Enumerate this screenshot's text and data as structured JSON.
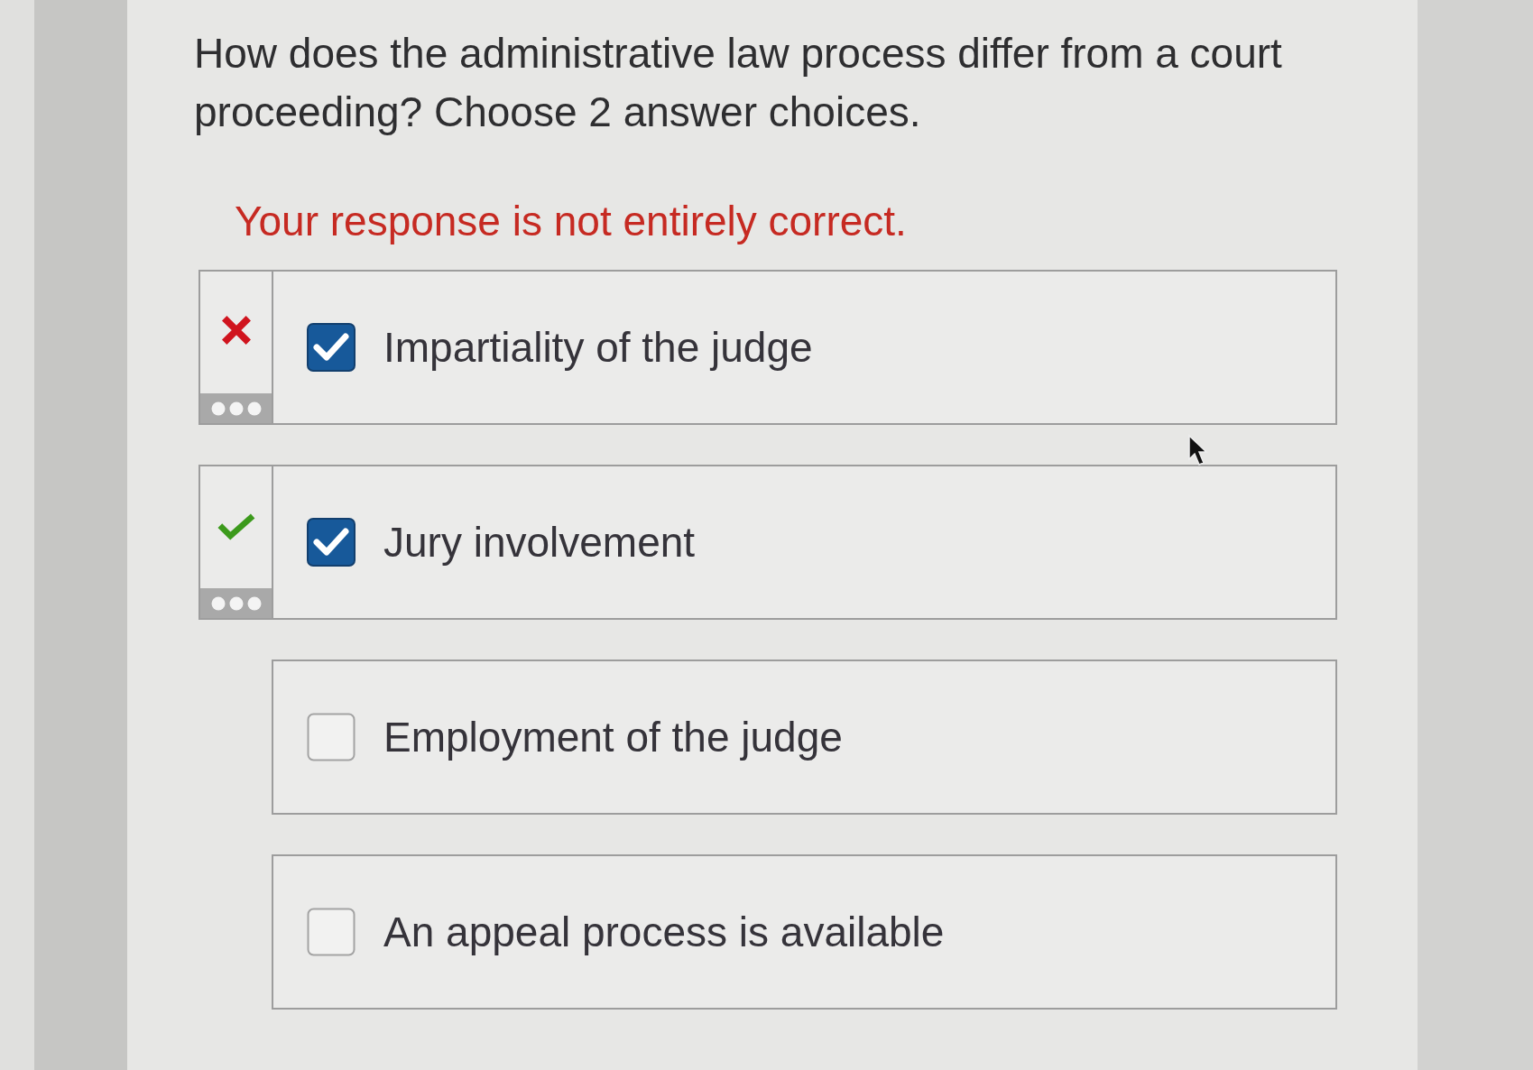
{
  "question": "How does the administrative law process differ from a court proceeding? Choose 2 answer choices.",
  "feedback": "Your response is not entirely correct.",
  "options": [
    {
      "label": "Impartiality of the judge",
      "checked": true,
      "kind": "wrong"
    },
    {
      "label": "Jury involvement",
      "checked": true,
      "kind": "right"
    },
    {
      "label": "Employment of the judge",
      "checked": false,
      "kind": "plain"
    },
    {
      "label": "An appeal process is available",
      "checked": false,
      "kind": "plain"
    }
  ]
}
